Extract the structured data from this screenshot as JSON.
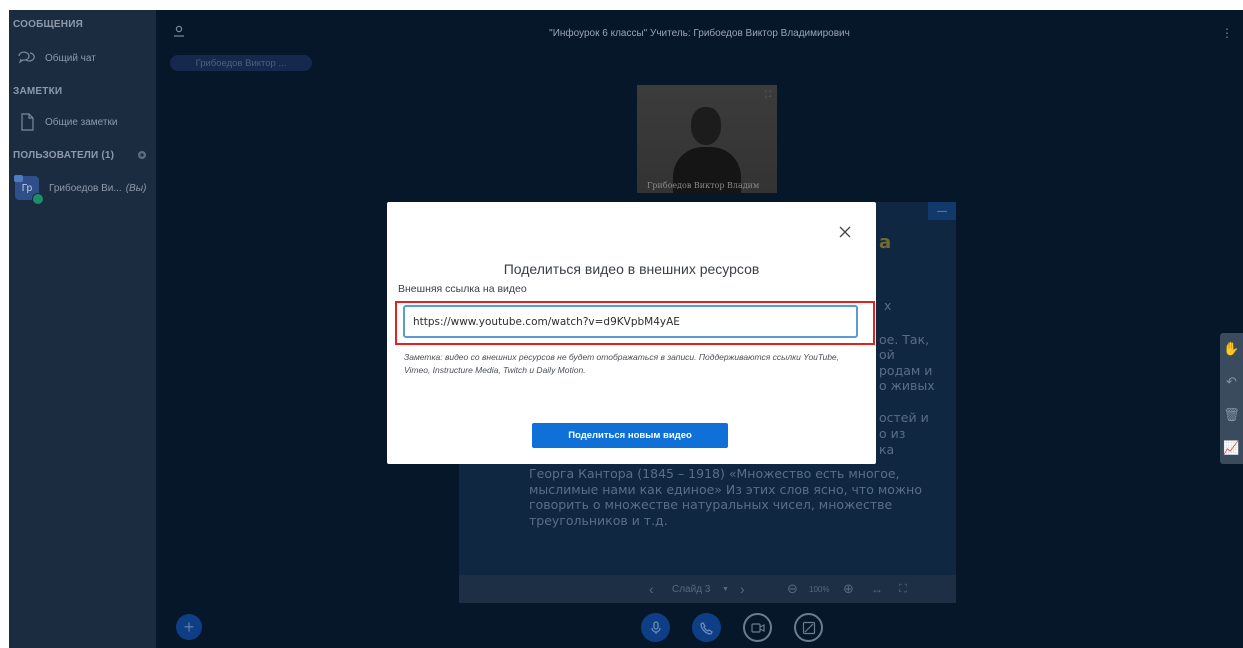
{
  "sidebar": {
    "messages_heading": "СООБЩЕНИЯ",
    "public_chat_label": "Общий чат",
    "notes_heading": "ЗАМЕТКИ",
    "shared_notes_label": "Общие заметки",
    "users_heading": "ПОЛЬЗОВАТЕЛИ (1)",
    "user": {
      "initials": "Гр",
      "name": "Грибоедов Ви...",
      "you_tag": "(Вы)"
    }
  },
  "header": {
    "meeting_title": "\"Инфоурок 6 классы\" Учитель: Грибоедов Виктор Владимирович",
    "more_icon": "more-vertical-icon"
  },
  "talker_pill": "Грибоедов Виктор ...",
  "webcam": {
    "name_label": "Грибоедов Виктор Владим"
  },
  "slide": {
    "title_fragment": "а",
    "fragments": [
      "х",
      "ое. Так,",
      "ой",
      "родам и",
      "о живых",
      "остей и",
      "о из",
      "ка"
    ],
    "body_lines": [
      "Георга Кантора (1845 – 1918) «Множество есть многое,",
      "мыслимые нами как единое» Из этих слов ясно, что можно",
      "говорить о множестве натуральных чисел, множестве",
      "треугольников и т.д."
    ],
    "minimize_label": "—"
  },
  "slide_controls": {
    "slide_label": "Слайд 3",
    "zoom_label": "100%"
  },
  "modal": {
    "title": "Поделиться видео в внешних ресурсов",
    "label": "Внешняя ссылка на видео",
    "url_value": "https://www.youtube.com/watch?v=d9KVpbM4yAE",
    "note": "Заметка: видео со внешних ресурсов не будет отображаться в записи. Поддерживаются ссылки YouTube, Vimeo, Instructure Media, Twitch и Daily Motion.",
    "share_button": "Поделиться новым видео"
  },
  "colors": {
    "primary_button": "#0f70d7",
    "highlight_border": "#e3211d",
    "input_focus": "#5b9bd5",
    "app_background": "#06172a",
    "sidebar_background": "#1b2c40"
  }
}
